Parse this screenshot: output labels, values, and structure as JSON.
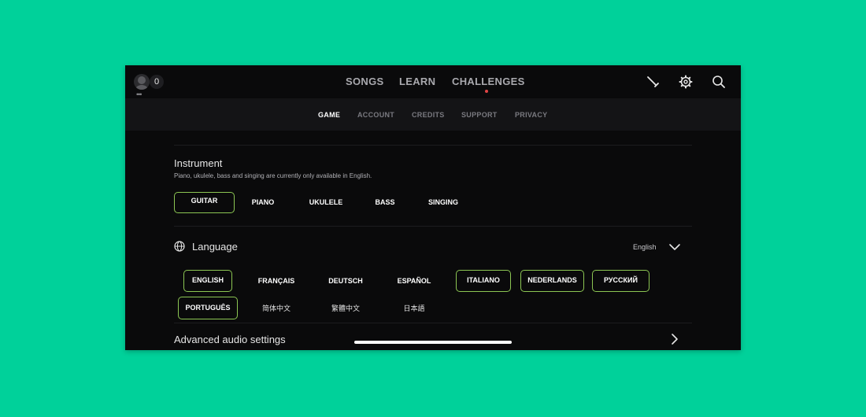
{
  "profile": {
    "coin_count": "0",
    "more": "•••"
  },
  "nav": {
    "tabs": [
      {
        "label": "SONGS"
      },
      {
        "label": "LEARN"
      },
      {
        "label": "CHALLENGES"
      }
    ],
    "icons": [
      "tuner-icon",
      "gear-icon",
      "search-icon"
    ]
  },
  "settings_tabs": [
    {
      "label": "GAME",
      "active": true
    },
    {
      "label": "ACCOUNT",
      "active": false
    },
    {
      "label": "CREDITS",
      "active": false
    },
    {
      "label": "SUPPORT",
      "active": false
    },
    {
      "label": "PRIVACY",
      "active": false
    }
  ],
  "instrument": {
    "title": "Instrument",
    "subtitle": "Piano, ukulele, bass and singing are currently only available in English.",
    "options": [
      {
        "label": "GUITAR",
        "selected": true
      },
      {
        "label": "PIANO",
        "selected": false
      },
      {
        "label": "UKULELE",
        "selected": false
      },
      {
        "label": "BASS",
        "selected": false
      },
      {
        "label": "SINGING",
        "selected": false
      }
    ]
  },
  "language": {
    "title": "Language",
    "current": "English",
    "options": [
      {
        "label": "ENGLISH",
        "selected": true
      },
      {
        "label": "FRANÇAIS",
        "selected": false
      },
      {
        "label": "DEUTSCH",
        "selected": false
      },
      {
        "label": "ESPAÑOL",
        "selected": false
      },
      {
        "label": "ITALIANO",
        "selected": true
      },
      {
        "label": "NEDERLANDS",
        "selected": true
      },
      {
        "label": "РУССКИЙ",
        "selected": true
      },
      {
        "label": "PORTUGUÊS",
        "selected": true
      },
      {
        "label": "简体中文",
        "selected": false
      },
      {
        "label": "繁體中文",
        "selected": false
      },
      {
        "label": "日本語",
        "selected": false
      }
    ]
  },
  "advanced": {
    "label": "Advanced audio settings"
  },
  "colors": {
    "background": "#00d19a",
    "app_bg": "#0a0a0b",
    "selected_border": "#8cc653",
    "notification": "#e04545"
  }
}
